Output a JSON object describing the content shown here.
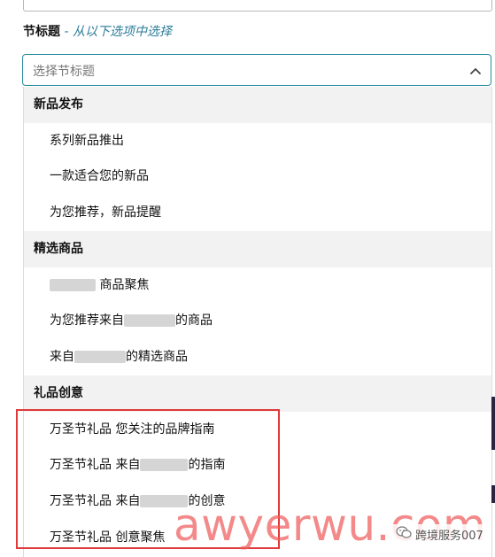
{
  "form": {
    "section_title": "节标题",
    "separator": " - ",
    "hint": "从以下选项中选择",
    "select_placeholder": "选择节标题"
  },
  "dropdown": {
    "groups": [
      {
        "label": "新品发布",
        "options": [
          "系列新品推出",
          "一款适合您的新品",
          "为您推荐，新品提醒"
        ]
      },
      {
        "label": "精选商品",
        "options": [
          {
            "before": "",
            "after": " 商品聚焦"
          },
          {
            "before": "为您推荐来自",
            "after": "的商品"
          },
          {
            "before": "来自",
            "after": "的精选商品"
          }
        ]
      },
      {
        "label": "礼品创意",
        "options": [
          "万圣节礼品 您关注的品牌指南",
          {
            "before": "万圣节礼品 来自",
            "after": "的指南"
          },
          {
            "before": "万圣节礼品 来自",
            "after": "的创意"
          },
          "万圣节礼品 创意聚焦"
        ]
      }
    ]
  },
  "overlays": {
    "watermark": "awyerwu.com",
    "wechat_account": "跨境服务007"
  },
  "colors": {
    "accent": "#2a8a9e",
    "hint_text": "#2e7d99",
    "group_bg": "#f2f2f2",
    "highlight_box": "#e03a3a",
    "watermark": "#ee5c5c"
  },
  "icons": {
    "select_toggle": "chevron-up-icon",
    "wechat": "wechat-icon"
  }
}
